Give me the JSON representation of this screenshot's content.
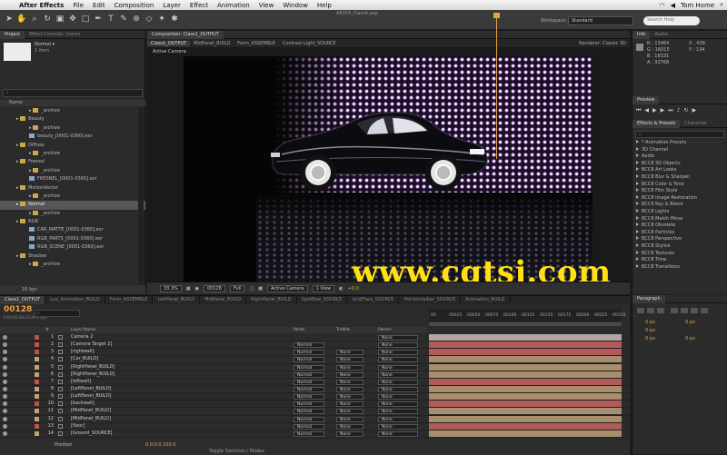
{
  "menubar": {
    "app_name": "After Effects",
    "items": [
      "File",
      "Edit",
      "Composition",
      "Layer",
      "Effect",
      "Animation",
      "View",
      "Window",
      "Help"
    ],
    "user": "Tom Home"
  },
  "toolbar": {
    "window_title": "AE024_Class4.aep",
    "workspace_label": "Workspace:",
    "workspace_value": "Standard",
    "search_placeholder": "Search Help"
  },
  "project_panel": {
    "tabs": [
      "Project",
      "Effect Controls: (none)"
    ],
    "thumb_name": "Normal ▾",
    "thumb_count": "1 item",
    "search_placeholder": "⌕",
    "header_name": "Name",
    "items": [
      {
        "name": "_archive",
        "kind": "folder",
        "indent": 2
      },
      {
        "name": "Beauty",
        "kind": "folder",
        "indent": 1
      },
      {
        "name": "_archive",
        "kind": "folder",
        "indent": 2
      },
      {
        "name": "beauty_[0001-0360].exr",
        "kind": "seq",
        "indent": 2
      },
      {
        "name": "Diffuse",
        "kind": "folder",
        "indent": 1
      },
      {
        "name": "_archive",
        "kind": "folder",
        "indent": 2
      },
      {
        "name": "Fresnel",
        "kind": "folder",
        "indent": 1
      },
      {
        "name": "_archive",
        "kind": "folder",
        "indent": 2
      },
      {
        "name": "FRESNEL_[0001-0360].exr",
        "kind": "seq",
        "indent": 2
      },
      {
        "name": "MotionVector",
        "kind": "folder",
        "indent": 1
      },
      {
        "name": "_archive",
        "kind": "folder",
        "indent": 2
      },
      {
        "name": "Normal",
        "kind": "folder",
        "indent": 1,
        "selected": true
      },
      {
        "name": "_archive",
        "kind": "folder",
        "indent": 2
      },
      {
        "name": "RGB",
        "kind": "folder",
        "indent": 1
      },
      {
        "name": "CAR_MATTE_[0001-0360].exr",
        "kind": "seq",
        "indent": 2
      },
      {
        "name": "RGB_PARTS_[0001-0360].exr",
        "kind": "seq",
        "indent": 2
      },
      {
        "name": "RGB_SCENE_[0001-0360].exr",
        "kind": "seq",
        "indent": 2
      },
      {
        "name": "Shadow",
        "kind": "folder",
        "indent": 1
      },
      {
        "name": "_archive",
        "kind": "folder",
        "indent": 2
      }
    ],
    "footer": "16 bpc"
  },
  "comp_panel": {
    "tab": "Composition: Class1_OUTPUT",
    "crumbs": [
      "Class1_OUTPUT",
      "MidPanel_BUILD",
      "Form_ASSEMBLE",
      "Contrast Light_SOURCE"
    ],
    "renderer": "Renderer:  Classic 3D",
    "view_label": "Active Camera",
    "zoom": "33.3%",
    "timecode": "00128",
    "resolution": "Full",
    "camera": "Active Camera",
    "views": "1 View",
    "exposure": "+0.0"
  },
  "info_panel": {
    "tabs": [
      "Info",
      "Audio"
    ],
    "r": "R : 13464",
    "g": "G : 16015",
    "b": "B : 18331",
    "a": "A : 32768",
    "x": "X : 439",
    "y": "Y : 134"
  },
  "preview_panel": {
    "tab": "Preview"
  },
  "effects_panel": {
    "tabs": [
      "Effects & Presets",
      "Character"
    ],
    "search_placeholder": "⌕",
    "items": [
      "* Animation Presets",
      "3D Channel",
      "Audio",
      "BCC8 3D Objects",
      "BCC8 Art Looks",
      "BCC8 Blur & Sharpen",
      "BCC8 Color & Tone",
      "BCC8 Film Style",
      "BCC8 Image Restoration",
      "BCC8 Key & Blend",
      "BCC8 Lights",
      "BCC8 Match Move",
      "BCC8 Obsolete",
      "BCC8 Particles",
      "BCC8 Perspective",
      "BCC8 Stylize",
      "BCC8 Textures",
      "BCC8 Time",
      "BCC8 Transitions"
    ]
  },
  "timeline": {
    "tabs": [
      "Class1_OUTPUT",
      "Lux_Animation_BUILD",
      "Form_ASSEMBLE",
      "LeftPanel_BUILD",
      "MidPanel_BUILD",
      "RightPanel_BUILD",
      "Spotflow_SOURCE",
      "GridFlare_SOURCE",
      "Horizontalbar_SOURCE",
      "Animation_BUILD"
    ],
    "current_time": "00128",
    "fps_info": "0:00:05:08 (23.976 fps)",
    "header": {
      "num": "#",
      "name": "Layer Name",
      "mode": "Mode",
      "trk": "TrkMat",
      "parent": "Parent"
    },
    "ruler_ticks": [
      "00",
      "00025",
      "00050",
      "00075",
      "00100",
      "00125",
      "00150",
      "00175",
      "00200",
      "00225",
      "00250"
    ],
    "layers": [
      {
        "num": "1",
        "name": "Camera 2",
        "color": "#c0504d",
        "bar": "#b5a4a4",
        "mode": "",
        "trk": "",
        "parent": "None"
      },
      {
        "num": "2",
        "name": "[Camera Target 2]",
        "color": "#c0504d",
        "bar": "#b25a5a",
        "mode": "Normal",
        "trk": "",
        "parent": "None"
      },
      {
        "num": "3",
        "name": "[rightwall]",
        "color": "#c0504d",
        "bar": "#b25a5a",
        "mode": "Normal",
        "trk": "None",
        "parent": "None"
      },
      {
        "num": "4",
        "name": "[Car_BUILD]",
        "color": "#c7a070",
        "bar": "#a88e6c",
        "mode": "Normal",
        "trk": "None",
        "parent": "None"
      },
      {
        "num": "5",
        "name": "[RightPanel_BUILD]",
        "color": "#c7a070",
        "bar": "#a88e6c",
        "mode": "Normal",
        "trk": "None",
        "parent": "None"
      },
      {
        "num": "6",
        "name": "[RightPanel_BUILD]",
        "color": "#c7a070",
        "bar": "#a88e6c",
        "mode": "Normal",
        "trk": "None",
        "parent": "None"
      },
      {
        "num": "7",
        "name": "[leftwall]",
        "color": "#c0504d",
        "bar": "#b25a5a",
        "mode": "Normal",
        "trk": "None",
        "parent": "None"
      },
      {
        "num": "8",
        "name": "[LeftPanel_BUILD]",
        "color": "#c7a070",
        "bar": "#a88e6c",
        "mode": "Normal",
        "trk": "None",
        "parent": "None"
      },
      {
        "num": "9",
        "name": "[LeftPanel_BUILD]",
        "color": "#c7a070",
        "bar": "#a88e6c",
        "mode": "Normal",
        "trk": "None",
        "parent": "None"
      },
      {
        "num": "10",
        "name": "[backwall]",
        "color": "#c0504d",
        "bar": "#b25a5a",
        "mode": "Normal",
        "trk": "None",
        "parent": "None"
      },
      {
        "num": "11",
        "name": "[MidPanel_BUILD]",
        "color": "#c7a070",
        "bar": "#a88e6c",
        "mode": "Normal",
        "trk": "None",
        "parent": "None"
      },
      {
        "num": "12",
        "name": "[MidPanel_BUILD]",
        "color": "#c7a070",
        "bar": "#a88e6c",
        "mode": "Normal",
        "trk": "None",
        "parent": "None"
      },
      {
        "num": "13",
        "name": "[floor]",
        "color": "#c0504d",
        "bar": "#b25a5a",
        "mode": "Normal",
        "trk": "None",
        "parent": "None"
      },
      {
        "num": "14",
        "name": "[Ground_SOURCE]",
        "color": "#c7a070",
        "bar": "#a88e6c",
        "mode": "Normal",
        "trk": "None",
        "parent": "None"
      }
    ],
    "bottom_prop": "Position",
    "bottom_value": "0.0,0.0,150.0",
    "bottom_toggle": "Toggle Switches / Modes"
  },
  "paragraph_panel": {
    "tab": "Paragraph",
    "f1": "0 px",
    "f2": "0 px",
    "f3": "0 px",
    "f4": "0 px",
    "f5": "0 px"
  },
  "watermark": "www.cgtsj.com",
  "colors": {
    "accent": "#e8a33a",
    "watermark": "#ffe014"
  }
}
